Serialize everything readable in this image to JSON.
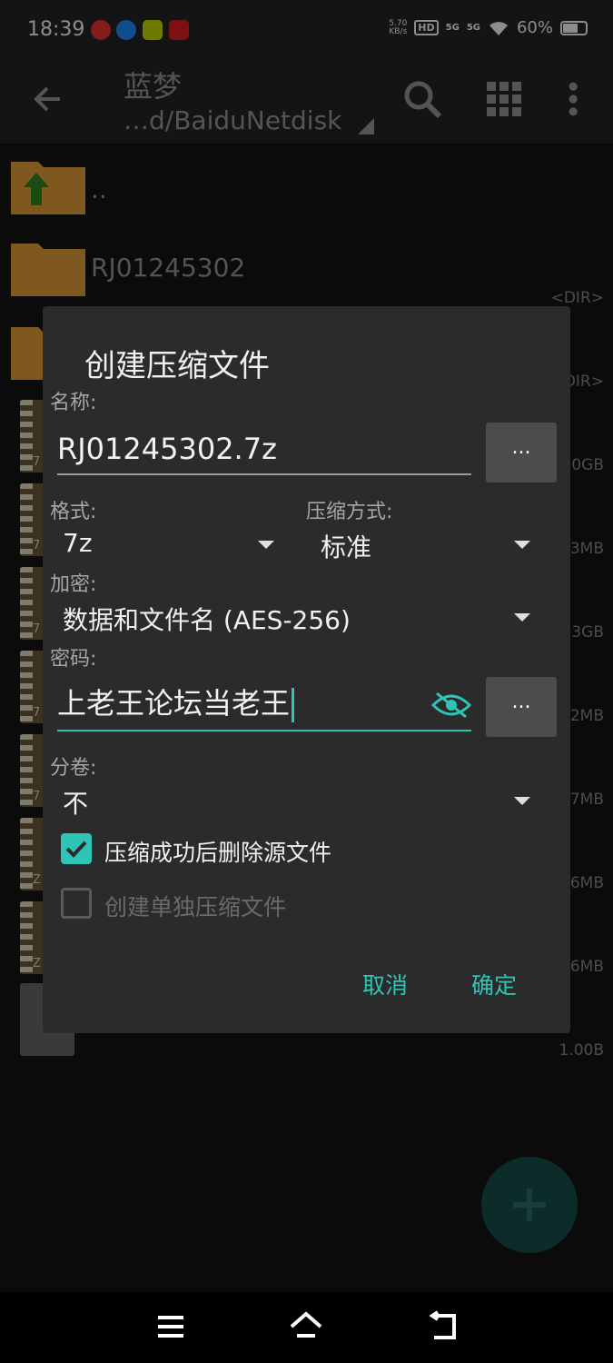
{
  "status_bar": {
    "time": "18:39",
    "net_speed_value": "5.70",
    "net_speed_unit": "KB/s",
    "hd_tag": "HD",
    "sim1_tag": "5G",
    "sim2_tag": "5G",
    "battery": "60%",
    "battery_level": 0.6
  },
  "app_bar": {
    "title": "蓝梦",
    "path": "…d/BaiduNetdisk",
    "icons": [
      "back-arrow-icon",
      "search-icon",
      "grid-view-icon",
      "more-vert-icon"
    ]
  },
  "file_list": {
    "items": [
      {
        "name": "..",
        "size": "",
        "type": "parent-folder"
      },
      {
        "name": "RJ01245302",
        "size": "<DIR>",
        "type": "folder"
      },
      {
        "name": "",
        "size": "DIR>",
        "type": "folder"
      },
      {
        "name": "",
        "size": "0GB",
        "type": "archive",
        "letter": "7"
      },
      {
        "name": "",
        "size": "3MB",
        "type": "archive",
        "letter": "7"
      },
      {
        "name": "",
        "size": "3GB",
        "type": "archive",
        "letter": "7"
      },
      {
        "name": "",
        "size": "2MB",
        "type": "archive",
        "letter": "7"
      },
      {
        "name": "",
        "size": "7MB",
        "type": "archive",
        "letter": "7"
      },
      {
        "name": "",
        "size": "6MB",
        "type": "archive",
        "letter": "Z"
      },
      {
        "name": "",
        "size": "6MB",
        "type": "archive",
        "letter": "Z"
      },
      {
        "name": "",
        "size": "1.00B",
        "type": "document"
      }
    ]
  },
  "dialog": {
    "title": "创建压缩文件",
    "name_label": "名称:",
    "name_value": "RJ01245302.7z",
    "more_button": "...",
    "format_label": "格式:",
    "format_value": "7z",
    "compression_label": "压缩方式:",
    "compression_value": "标准",
    "encryption_label": "加密:",
    "encryption_value": "数据和文件名 (AES-256)",
    "password_label": "密码:",
    "password_value": "上老王论坛当老王",
    "volume_label": "分卷:",
    "volume_value": "不",
    "delete_source_label": "压缩成功后删除源文件",
    "delete_source_checked": true,
    "separate_archive_label": "创建单独压缩文件",
    "separate_archive_checked": false,
    "cancel_label": "取消",
    "ok_label": "确定"
  },
  "colors": {
    "accent": "#2ec4b6",
    "dialog_bg": "#2b2b2b",
    "app_bar_bg": "#262626",
    "folder": "#e8a13a"
  }
}
